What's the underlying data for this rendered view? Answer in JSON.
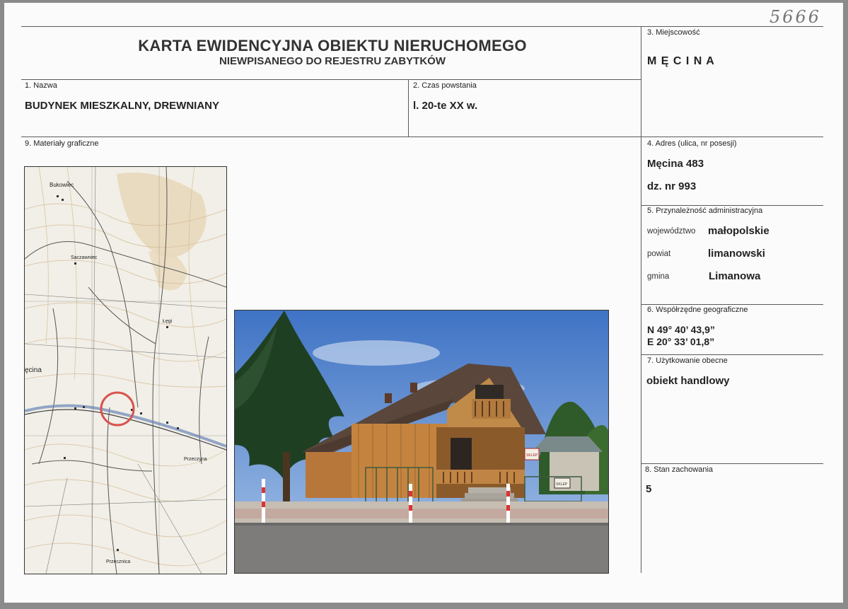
{
  "sheet_number": "5666",
  "header": {
    "title": "KARTA EWIDENCYJNA OBIEKTU NIERUCHOMEGO",
    "subtitle": "NIEWPISANEGO DO REJESTRU ZABYTKÓW"
  },
  "fields": {
    "name": {
      "label": "1. Nazwa",
      "value": "BUDYNEK MIESZKALNY, DREWNIANY"
    },
    "period": {
      "label": "2. Czas powstania",
      "value": "l. 20-te XX w."
    },
    "locality": {
      "label": "3. Miejscowość",
      "value": "M Ę C I N A"
    },
    "address": {
      "label": "4. Adres (ulica, nr posesji)",
      "street": "Męcina 483",
      "plot": "dz. nr 993"
    },
    "admin": {
      "label": "5. Przynależność administracyjna",
      "voivodeship_label": "województwo",
      "voivodeship": "małopolskie",
      "county_label": "powiat",
      "county": "limanowski",
      "commune_label": "gmina",
      "commune": "Limanowa"
    },
    "coords": {
      "label": "6. Współrzędne geograficzne",
      "lat": "N 49° 40’ 43,9”",
      "lon": "E 20° 33’ 01,8”"
    },
    "usage": {
      "label": "7. Użytkowanie obecne",
      "value": "obiekt handlowy"
    },
    "condition": {
      "label": "8. Stan zachowania",
      "value": "5"
    },
    "graphics": {
      "label": "9. Materiały graficzne"
    }
  },
  "map": {
    "labels": {
      "bukowiec": "Bukowiec",
      "bieczek": "Saczawniec",
      "legi": "Łęgi",
      "mecina": "ęcina",
      "przeczyna": "Przeczyna",
      "przecznica": "Przecznica"
    },
    "marker_color": "#d9534f"
  },
  "photo": {
    "signs": {
      "sign1": "SKLEP",
      "sign2": "SKLEP"
    }
  }
}
